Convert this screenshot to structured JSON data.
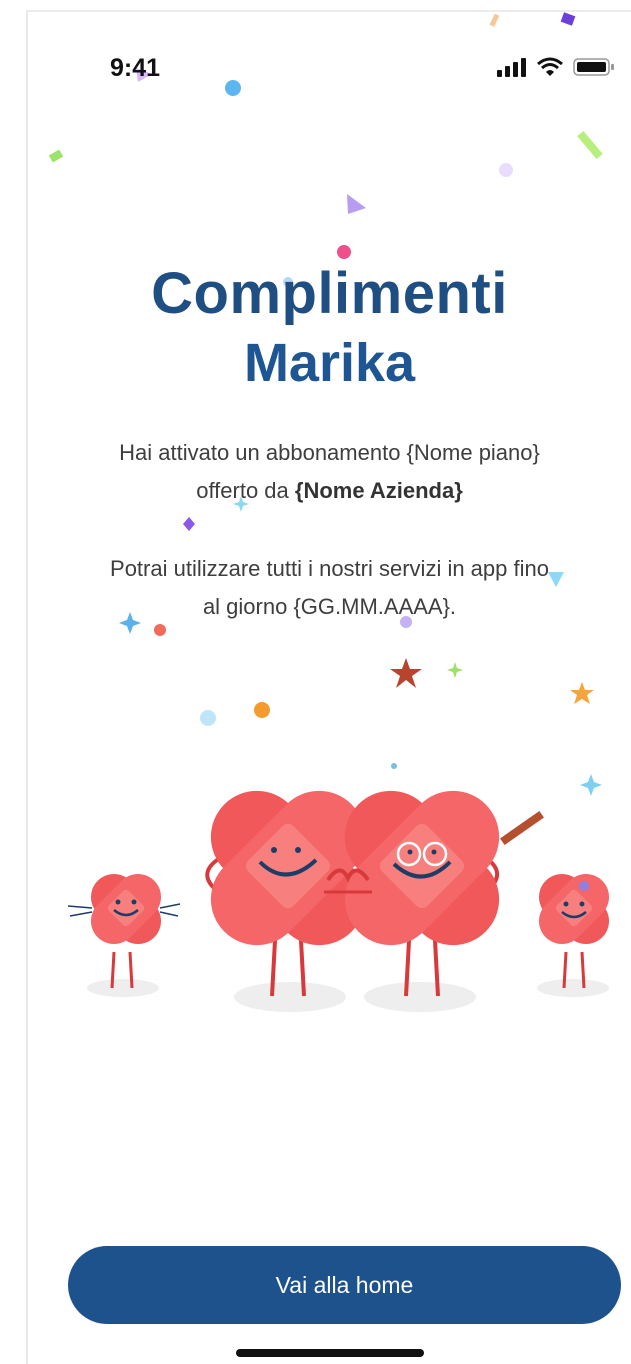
{
  "status_bar": {
    "time": "9:41"
  },
  "heading": {
    "line1": "Complimenti",
    "line2": "Marika"
  },
  "message": {
    "line1_prefix": "Hai attivato un abbonamento {Nome piano}",
    "line2_prefix": "offerto da ",
    "company": "{Nome Azienda}",
    "line3": "Potrai utilizzare tutti i nostri servizi in app fino",
    "line4": "al giorno {GG.MM.AAAA}."
  },
  "cta": {
    "label": "Vai alla home"
  },
  "colors": {
    "primary": "#1e528d",
    "heading": "#1f4e82",
    "mascot": "#f0585a",
    "mascot_light": "#f7807f",
    "mascot_outline": "#d8393b",
    "shadow": "#eeeeee"
  },
  "icons": [
    "signal-icon",
    "wifi-icon",
    "battery-icon"
  ]
}
